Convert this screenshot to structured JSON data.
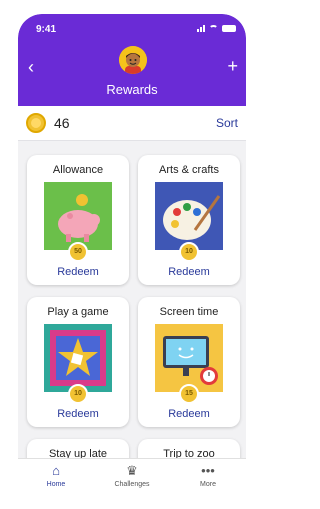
{
  "status_bar": {
    "time": "9:41"
  },
  "header": {
    "title": "Rewards"
  },
  "points": {
    "value": "46",
    "sort_label": "Sort"
  },
  "rewards": [
    {
      "name": "Allowance",
      "cost": "50",
      "action": "Redeem"
    },
    {
      "name": "Arts & crafts",
      "cost": "10",
      "action": "Redeem"
    },
    {
      "name": "Play a game",
      "cost": "10",
      "action": "Redeem"
    },
    {
      "name": "Screen time",
      "cost": "15",
      "action": "Redeem"
    },
    {
      "name": "Stay up late"
    },
    {
      "name": "Trip to zoo"
    }
  ],
  "tabs": [
    {
      "label": "Home",
      "icon": "home-icon",
      "active": true
    },
    {
      "label": "Challenges",
      "icon": "trophy-icon",
      "active": false
    },
    {
      "label": "More",
      "icon": "more-icon",
      "active": false
    }
  ],
  "colors": {
    "brand": "#6a2bd6",
    "link": "#2a3a9a",
    "coin": "#f1c232"
  }
}
